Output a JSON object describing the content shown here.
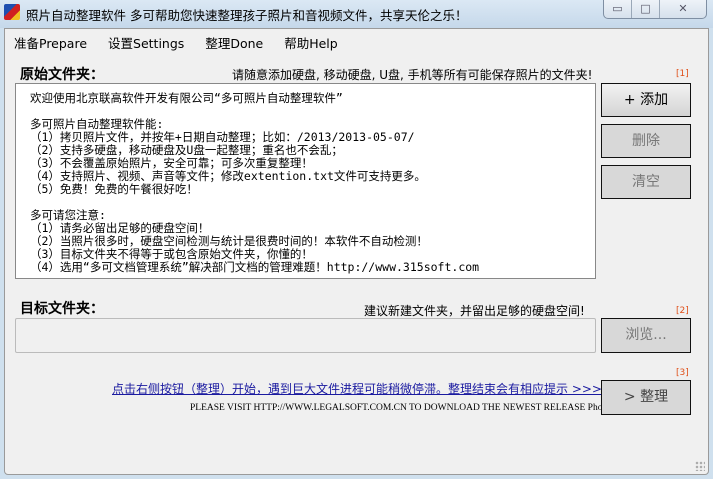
{
  "window": {
    "title": "照片自动整理软件 多可帮助您快速整理孩子照片和音视频文件，共享天伦之乐！",
    "min": "▭",
    "max": "□",
    "close": "✕"
  },
  "menu": [
    "准备Prepare",
    "设置Settings",
    "整理Done",
    "帮助Help"
  ],
  "source": {
    "label": "原始文件夹：",
    "hint": "请随意添加硬盘, 移动硬盘, U盘, 手机等所有可能保存照片的文件夹!",
    "marker": "[1]",
    "text": "欢迎使用北京联高软件开发有限公司“多可照片自动整理软件”\n\n多可照片自动整理软件能:\n（1）拷贝照片文件，并按年+日期自动整理；比如：/2013/2013-05-07/\n（2）支持多硬盘，移动硬盘及U盘一起整理；重名也不会乱；\n（3）不会覆盖原始照片，安全可靠；可多次重复整理！\n（4）支持照片、视频、声音等文件；修改extention.txt文件可支持更多。\n（5）免费！免费的午餐很好吃！\n\n多可请您注意:\n（1）请务必留出足够的硬盘空间！\n（2）当照片很多时，硬盘空间检测与统计是很费时间的！本软件不自动检测！\n（3）目标文件夹不得等于或包含原始文件夹，你懂的！\n（4）选用“多可文档管理系统”解决部门文档的管理难题！http://www.315soft.com",
    "add": "+ 添加",
    "delete": "删除",
    "clear": "清空"
  },
  "target": {
    "label": "目标文件夹：",
    "hint": "建议新建文件夹，并留出足够的硬盘空间!",
    "marker": "[2]",
    "value": "",
    "browse": "浏览..."
  },
  "run": {
    "marker": "[3]",
    "link": "点击右侧按钮（整理）开始，遇到巨大文件进程可能稍微停滞。整理结束会有相应提示 >>>",
    "visit": "PLEASE VISIT HTTP://WWW.LEGALSOFT.COM.CN TO DOWNLOAD THE NEWEST RELEASE PhotoIS!",
    "button": "> 整理"
  }
}
